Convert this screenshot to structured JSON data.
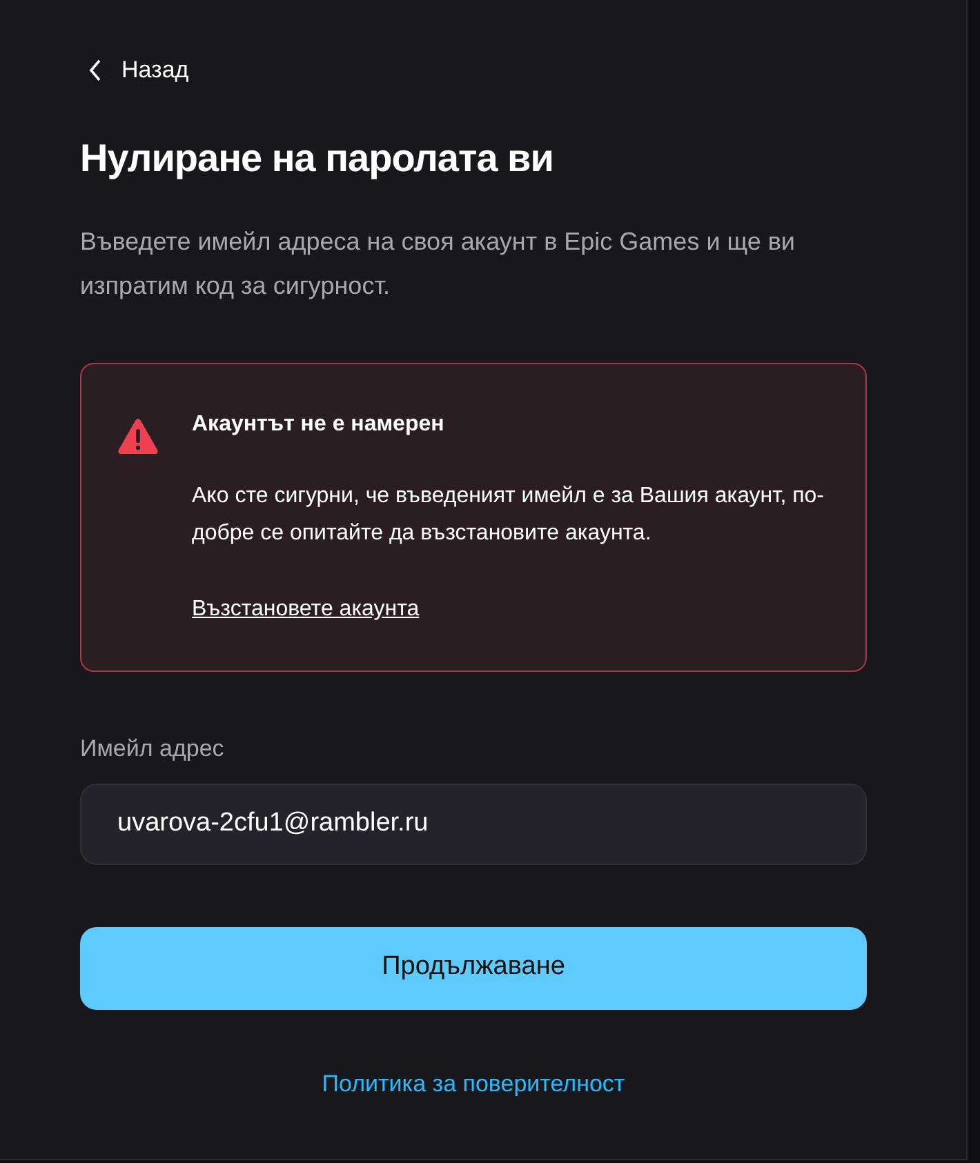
{
  "back": {
    "label": "Назад"
  },
  "title": "Нулиране на паролата ви",
  "description": "Въведете имейл адреса на своя акаунт в Epic Games и ще ви изпратим код за сигурност.",
  "alert": {
    "title": "Акаунтът не е намерен",
    "body": "Ако сте сигурни, че въведеният имейл е за Вашия акаунт, по-добре се опитайте да възстановите акаунта.",
    "link": "Възстановете акаунта"
  },
  "email": {
    "label": "Имейл адрес",
    "value": "uvarova-2cfu1@rambler.ru"
  },
  "submit": {
    "label": "Продължаване"
  },
  "privacy_link": "Политика за поверителност"
}
